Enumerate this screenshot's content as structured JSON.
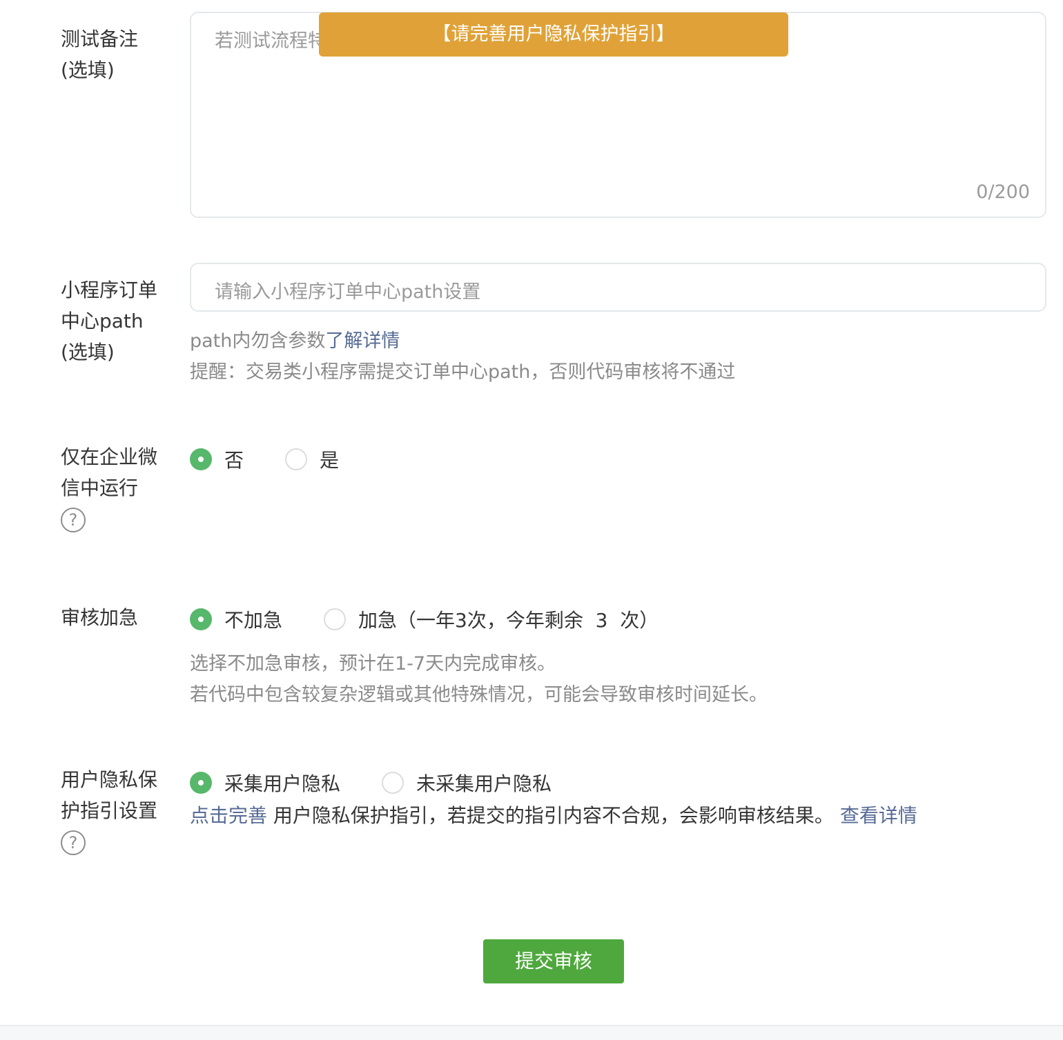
{
  "test_notes": {
    "label_line1": "测试备注",
    "label_line2": "(选填)",
    "placeholder": "若测试流程特",
    "counter": "0/200"
  },
  "toast": {
    "text": "【请完善用户隐私保护指引】"
  },
  "order_path": {
    "label_line1": "小程序订单",
    "label_line2": "中心path",
    "label_line3": "(选填)",
    "placeholder": "请输入小程序订单中心path设置",
    "tip1_text": "path内勿含参数",
    "tip1_link": "了解详情",
    "tip2": "提醒：交易类小程序需提交订单中心path，否则代码审核将不通过"
  },
  "wework_only": {
    "label_line1": "仅在企业微",
    "label_line2": "信中运行",
    "help_icon": "?",
    "options": [
      {
        "label": "否",
        "selected": true
      },
      {
        "label": "是",
        "selected": false
      }
    ]
  },
  "urgent": {
    "label": "审核加急",
    "options": [
      {
        "label": "不加急",
        "selected": true
      },
      {
        "label": "加急（一年3次，今年剩余  3  次）",
        "selected": false
      }
    ],
    "desc1": "选择不加急审核，预计在1-7天内完成审核。",
    "desc2": "若代码中包含较复杂逻辑或其他特殊情况，可能会导致审核时间延长。"
  },
  "privacy": {
    "label_line1": "用户隐私保",
    "label_line2": "护指引设置",
    "help_icon": "?",
    "options": [
      {
        "label": "采集用户隐私",
        "selected": true
      },
      {
        "label": "未采集用户隐私",
        "selected": false
      }
    ],
    "tip_link1": "点击完善",
    "tip_text": " 用户隐私保护指引，若提交的指引内容不合规，会影响审核结果。 ",
    "tip_link2": "查看详情"
  },
  "submit_label": "提交审核",
  "colors": {
    "accent_green": "#57b76b",
    "button_green": "#4fa83d",
    "toast_orange": "#e0a238",
    "link_blue": "#576b95"
  }
}
